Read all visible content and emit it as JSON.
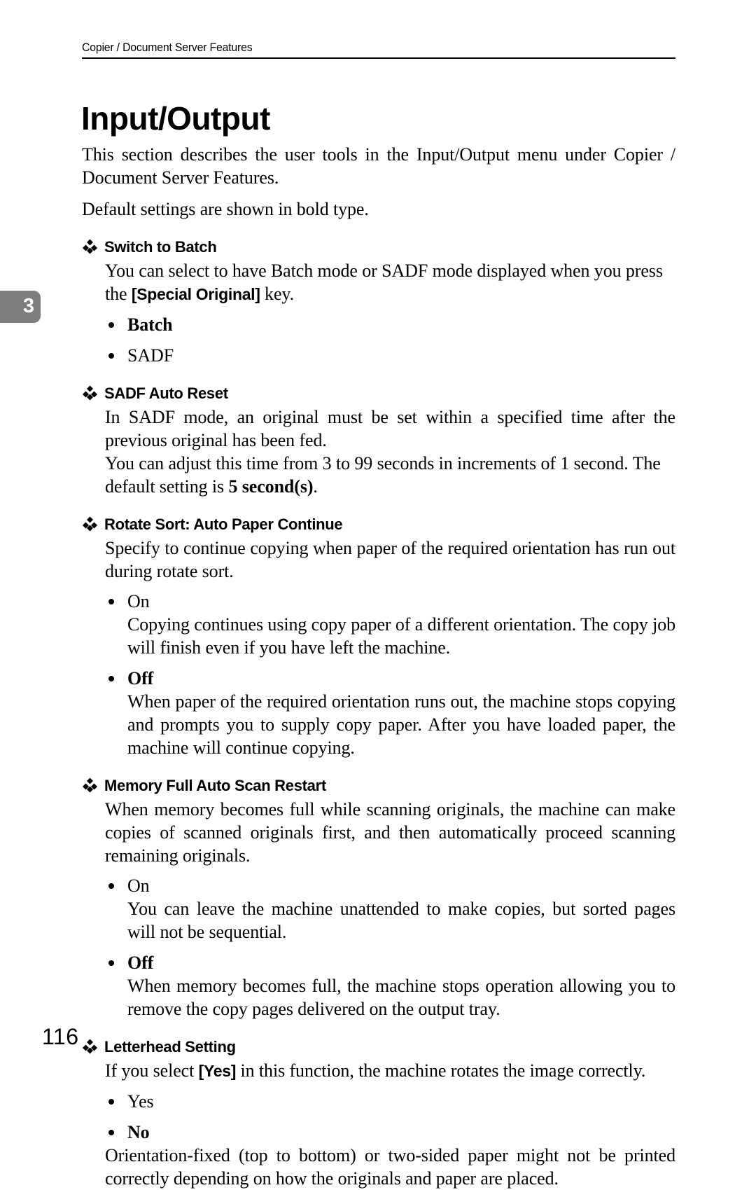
{
  "header": {
    "running_title": "Copier / Document Server Features"
  },
  "chapter_tab": {
    "number": "3",
    "color": "#7d7d7d"
  },
  "title": "Input/Output",
  "intro": {
    "paragraph_1": "This section describes the user tools in the Input/Output menu under Copier / Document Server Features.",
    "paragraph_2": "Default settings are shown in bold type."
  },
  "sections": [
    {
      "heading": "Switch to Batch",
      "icon": "diamond-bullet-icon",
      "body_prefix": "You can select to have Batch mode or SADF mode displayed when you press the ",
      "key_label": "[Special Original]",
      "body_suffix": " key.",
      "bullets": [
        {
          "label": "Batch",
          "bold": true,
          "description": ""
        },
        {
          "label": "SADF",
          "bold": false,
          "description": ""
        }
      ]
    },
    {
      "heading": "SADF Auto Reset",
      "icon": "diamond-bullet-icon",
      "paragraph_1": "In SADF mode, an original must be set within a specified time after the previous original has been fed.",
      "paragraph_2_prefix": "You can adjust this time from 3 to 99 seconds in increments of 1 second. The default setting is ",
      "paragraph_2_bold": "5 second(s)",
      "paragraph_2_suffix": "."
    },
    {
      "heading": "Rotate Sort: Auto Paper Continue",
      "icon": "diamond-bullet-icon",
      "paragraph_1": "Specify to continue copying when paper of the required orientation has run out during rotate sort.",
      "bullets": [
        {
          "label": "On",
          "bold": false,
          "description": "Copying continues using copy paper of a different orientation. The copy job will finish even if you have left the machine."
        },
        {
          "label": "Off",
          "bold": true,
          "description": "When paper of the required orientation runs out, the machine stops copying and prompts you to supply copy paper. After you have loaded paper, the machine will continue copying."
        }
      ]
    },
    {
      "heading": "Memory Full Auto Scan Restart",
      "icon": "diamond-bullet-icon",
      "paragraph_1": "When memory becomes full while scanning originals, the machine can make copies of scanned originals first, and then automatically proceed scanning remaining originals.",
      "bullets": [
        {
          "label": "On",
          "bold": false,
          "description": "You can leave the machine unattended to make copies, but sorted pages will not be sequential."
        },
        {
          "label": "Off",
          "bold": true,
          "description": "When memory becomes full, the machine stops operation allowing you to remove the copy pages delivered on the output tray."
        }
      ]
    },
    {
      "heading": "Letterhead Setting",
      "icon": "diamond-bullet-icon",
      "body_prefix": "If you select ",
      "key_label": "[Yes]",
      "body_suffix": " in this function, the machine rotates the image correctly.",
      "bullets": [
        {
          "label": "Yes",
          "bold": false,
          "description": ""
        },
        {
          "label": "No",
          "bold": true,
          "description": ""
        }
      ],
      "closing_paragraph": "Orientation-fixed (top to bottom) or two-sided paper might not be printed correctly depending on how the originals and paper are placed."
    }
  ],
  "page_number": "116"
}
